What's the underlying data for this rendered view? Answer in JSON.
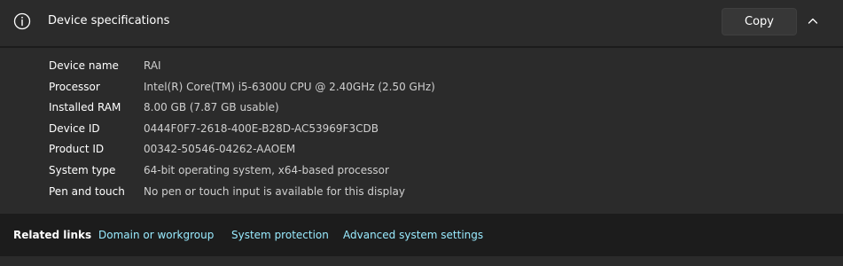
{
  "header": {
    "title": "Device specifications",
    "copy_label": "Copy"
  },
  "specs": [
    {
      "label": "Device name",
      "value": "RAI"
    },
    {
      "label": "Processor",
      "value": "Intel(R) Core(TM) i5-6300U CPU @ 2.40GHz (2.50 GHz)"
    },
    {
      "label": "Installed RAM",
      "value": "8.00 GB (7.87 GB usable)"
    },
    {
      "label": "Device ID",
      "value": "0444F0F7-2618-400E-B28D-AC53969F3CDB"
    },
    {
      "label": "Product ID",
      "value": "00342-50546-04262-AAOEM"
    },
    {
      "label": "System type",
      "value": "64-bit operating system, x64-based processor"
    },
    {
      "label": "Pen and touch",
      "value": "No pen or touch input is available for this display"
    }
  ],
  "related": {
    "label": "Related links",
    "links": [
      "Domain or workgroup",
      "System protection",
      "Advanced system settings"
    ]
  },
  "icons": {
    "info": "info-circle-icon",
    "collapse": "chevron-up-icon"
  },
  "colors": {
    "background": "#1c1c1c",
    "card": "#2b2b2b",
    "link": "#99ebff"
  }
}
